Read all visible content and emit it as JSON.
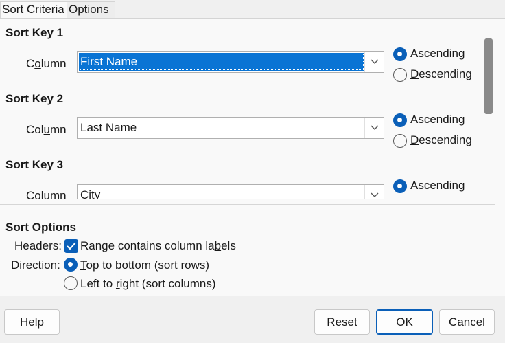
{
  "tabs": {
    "sort_criteria": "Sort Criteria",
    "options": "Options"
  },
  "sort_keys": [
    {
      "heading": "Sort Key 1",
      "column_label_pre": "C",
      "column_label_u": "o",
      "column_label_post": "lumn",
      "column_value": "First Name",
      "ascending_label_u": "A",
      "ascending_label_post": "scending",
      "descending_label_u": "D",
      "descending_label_post": "escending",
      "order": "ascending"
    },
    {
      "heading": "Sort Key 2",
      "column_label_pre": "Col",
      "column_label_u": "u",
      "column_label_post": "mn",
      "column_value": "Last Name",
      "ascending_label_u": "A",
      "ascending_label_post": "scending",
      "descending_label_u": "D",
      "descending_label_post": "escending",
      "order": "ascending"
    },
    {
      "heading": "Sort Key 3",
      "column_label": "Column",
      "column_value": "City",
      "ascending_label_u": "A",
      "ascending_label_post": "scending",
      "order": "ascending"
    }
  ],
  "sort_options": {
    "heading": "Sort Options",
    "headers_label": "Headers:",
    "headers_check_pre": "Range contains column la",
    "headers_check_u": "b",
    "headers_check_post": "els",
    "headers_checked": true,
    "direction_label": "Direction:",
    "top_to_bottom_u": "T",
    "top_to_bottom_post": "op to bottom (sort rows)",
    "left_to_right_pre": "Left to ",
    "left_to_right_u": "r",
    "left_to_right_post": "ight (sort columns)",
    "direction": "top_to_bottom"
  },
  "buttons": {
    "help_u": "H",
    "help_post": "elp",
    "reset_u": "R",
    "reset_post": "eset",
    "ok_u": "O",
    "ok_post": "K",
    "cancel_u": "C",
    "cancel_post": "ancel"
  },
  "colors": {
    "accent": "#0a5fb8",
    "selection": "#0a74d4"
  }
}
